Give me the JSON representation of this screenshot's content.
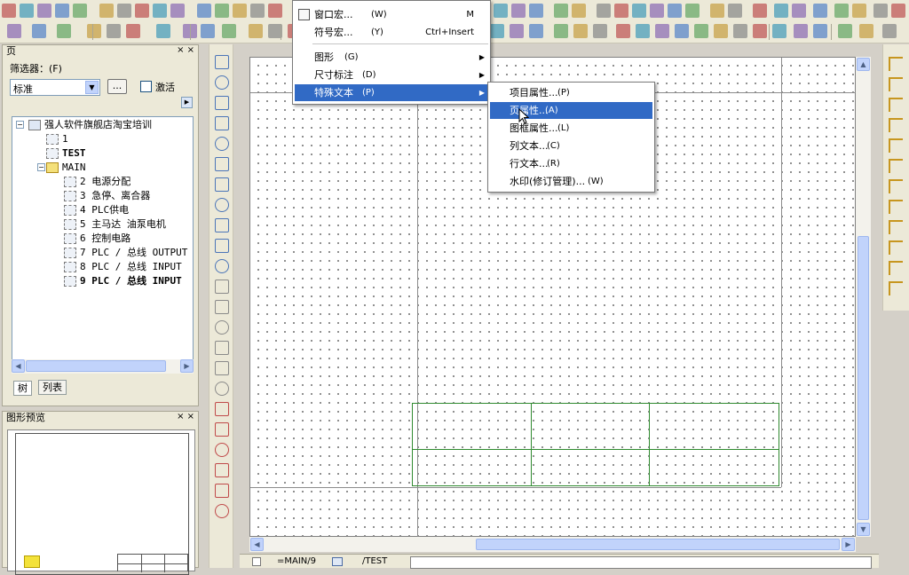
{
  "panels": {
    "pages": {
      "title": "页",
      "close": "× ×",
      "filter_label": "筛选器：(F)",
      "filter_value": "标准",
      "ellipsis": "...",
      "activate_label": "激活",
      "tree": [
        {
          "label": "强人软件旗舰店淘宝培训",
          "icon": "project-icon"
        },
        {
          "label": "1",
          "icon": "page-icon"
        },
        {
          "label": "TEST",
          "icon": "page-icon"
        },
        {
          "label": "MAIN",
          "icon": "folder-icon"
        },
        {
          "label": "2 电源分配",
          "icon": "page-icon"
        },
        {
          "label": "3 急停、离合器",
          "icon": "page-icon"
        },
        {
          "label": "4 PLC供电",
          "icon": "page-icon"
        },
        {
          "label": "5 主马达 油泵电机",
          "icon": "page-icon"
        },
        {
          "label": "6 控制电路",
          "icon": "page-icon"
        },
        {
          "label": "7 PLC / 总线 OUTPUT",
          "icon": "page-icon"
        },
        {
          "label": "8 PLC / 总线 INPUT",
          "icon": "page-icon"
        },
        {
          "label": "9 PLC / 总线 INPUT",
          "icon": "page-icon"
        }
      ],
      "tabs": [
        "树",
        "列表"
      ]
    },
    "preview": {
      "title": "图形预览",
      "close": "× ×"
    }
  },
  "menus": {
    "main": [
      {
        "label": "窗口宏...",
        "accel": "(W)",
        "shortcut": "M",
        "icon": "macro-icon"
      },
      {
        "label": "符号宏...",
        "accel": "(Y)",
        "shortcut": "Ctrl+Insert"
      },
      {
        "label": "图形",
        "accel": "(G)",
        "submenu": true
      },
      {
        "label": "尺寸标注",
        "accel": "(D)",
        "submenu": true
      },
      {
        "label": "特殊文本",
        "accel": "(P)",
        "submenu": true,
        "selected": true
      }
    ],
    "sub": [
      {
        "label": "项目属性...",
        "accel": "(P)"
      },
      {
        "label": "页属性...",
        "accel": "(A)",
        "selected": true
      },
      {
        "label": "图框属性...",
        "accel": "(L)"
      },
      {
        "label": "列文本...",
        "accel": "(C)"
      },
      {
        "label": "行文本...",
        "accel": "(R)"
      },
      {
        "label": "水印(修订管理)...",
        "accel": "(W)"
      }
    ]
  },
  "bottom_tabs": [
    "=MAIN/9",
    "/TEST"
  ],
  "colors": {
    "selection": "#316ac5",
    "frame": "#2f8a2f",
    "toolbar": "#ece9d8"
  }
}
